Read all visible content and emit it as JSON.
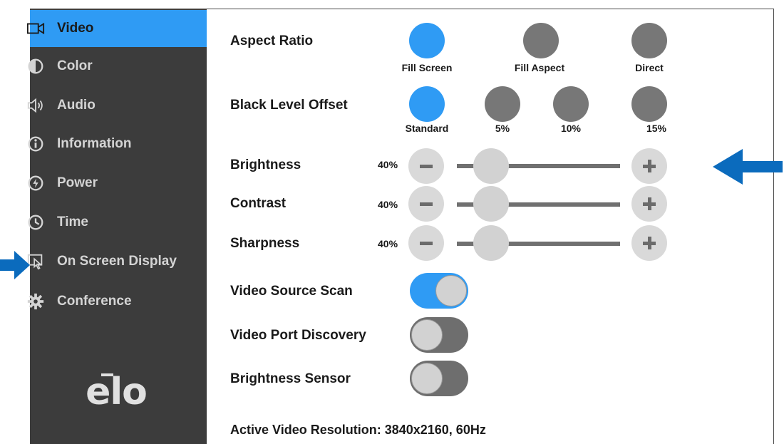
{
  "colors": {
    "accent": "#2f9bf4",
    "sidebar": "#3c3c3c",
    "callout_arrow": "#0b6bbd"
  },
  "sidebar": {
    "items": [
      {
        "label": "Video",
        "icon": "video-camera-icon",
        "active": true
      },
      {
        "label": "Color",
        "icon": "contrast-icon"
      },
      {
        "label": "Audio",
        "icon": "speaker-icon"
      },
      {
        "label": "Information",
        "icon": "info-icon"
      },
      {
        "label": "Power",
        "icon": "power-icon"
      },
      {
        "label": "Time",
        "icon": "clock-icon"
      },
      {
        "label": "On Screen Display",
        "icon": "osd-touch-icon"
      },
      {
        "label": "Conference",
        "icon": "gear-icon"
      }
    ],
    "logo": "elo"
  },
  "aspect_ratio": {
    "label": "Aspect Ratio",
    "options": [
      "Fill Screen",
      "Fill Aspect",
      "Direct"
    ],
    "selected": "Fill Screen"
  },
  "black_level": {
    "label": "Black Level Offset",
    "options": [
      "Standard",
      "5%",
      "10%",
      "15%"
    ],
    "selected": "Standard"
  },
  "sliders": [
    {
      "label": "Brightness",
      "value_text": "40%",
      "value": 0.4
    },
    {
      "label": "Contrast",
      "value_text": "40%",
      "value": 0.4
    },
    {
      "label": "Sharpness",
      "value_text": "40%",
      "value": 0.4
    }
  ],
  "toggles": [
    {
      "label": "Video Source Scan",
      "on": true
    },
    {
      "label": "Video Port Discovery",
      "on": false
    },
    {
      "label": "Brightness Sensor",
      "on": false
    }
  ],
  "footer": {
    "resolution": "Active Video Resolution: 3840x2160, 60Hz"
  }
}
